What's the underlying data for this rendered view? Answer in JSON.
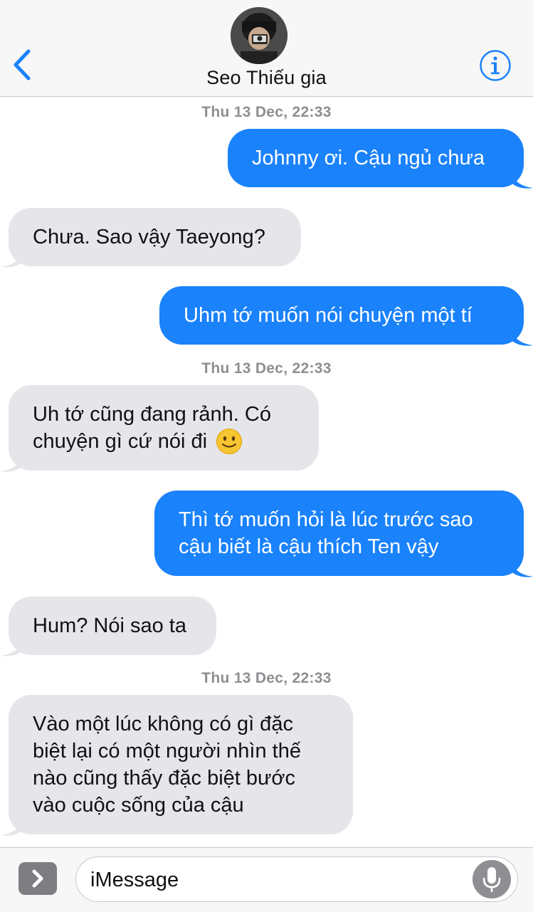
{
  "header": {
    "contact_name": "Seo Thiếu gia",
    "back_icon": "chevron-left-icon",
    "info_icon": "info-icon",
    "accent_color": "#1a82fb"
  },
  "messages": [
    {
      "type": "timestamp",
      "text": "Thu 13 Dec, 22:33"
    },
    {
      "type": "outgoing",
      "lines": [
        "Johnny ơi. Cậu ngủ chưa"
      ]
    },
    {
      "type": "incoming",
      "lines": [
        "Chưa. Sao vậy Taeyong?"
      ]
    },
    {
      "type": "outgoing",
      "lines": [
        "Uhm tớ muốn nói chuyện một tí"
      ]
    },
    {
      "type": "timestamp",
      "text": "Thu 13 Dec, 22:33"
    },
    {
      "type": "incoming",
      "lines": [
        "Uh tớ cũng đang rảnh. Có",
        "chuyện gì cứ nói đi"
      ],
      "emoji": "🙂"
    },
    {
      "type": "outgoing",
      "lines": [
        "Thì tớ muốn hỏi là lúc trước sao",
        "cậu biết là cậu thích Ten vậy"
      ]
    },
    {
      "type": "incoming",
      "lines": [
        "Hum? Nói sao ta"
      ]
    },
    {
      "type": "timestamp",
      "text": "Thu 13 Dec, 22:33"
    },
    {
      "type": "incoming",
      "lines": [
        "Vào một lúc không có gì đặc",
        "biệt lại có một người nhìn thế",
        "nào cũng thấy đặc biệt bước",
        "vào cuộc sống của cậu"
      ]
    }
  ],
  "input": {
    "placeholder": "iMessage",
    "apps_icon": "chevron-right-icon",
    "mic_icon": "microphone-icon"
  },
  "colors": {
    "outgoing_bubble": "#1a82fb",
    "incoming_bubble": "#e5e5ea",
    "timestamp": "#8e8e93"
  }
}
